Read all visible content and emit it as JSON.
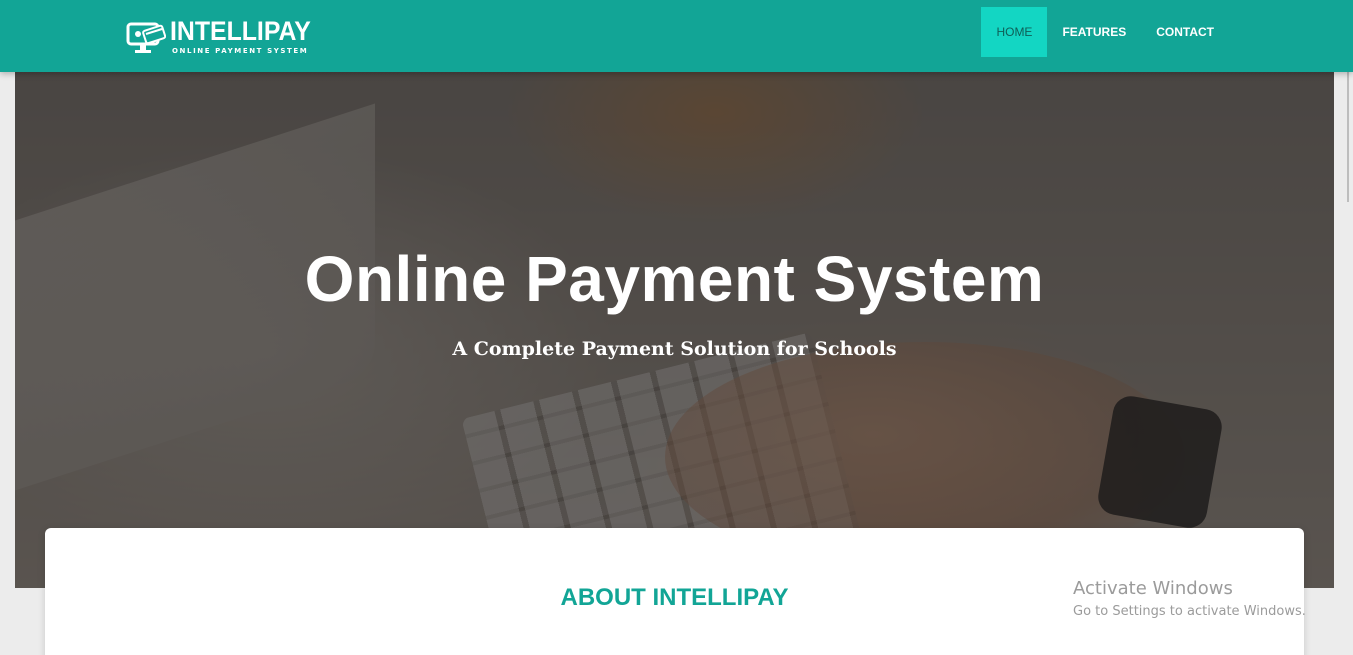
{
  "brand": {
    "name": "INTELLIPAY",
    "tagline": "ONLINE PAYMENT SYSTEM",
    "color": "#12a596"
  },
  "nav": {
    "items": [
      {
        "label": "HOME",
        "active": true
      },
      {
        "label": "FEATURES",
        "active": false
      },
      {
        "label": "CONTACT",
        "active": false
      }
    ],
    "active_color": "#13d6c3"
  },
  "hero": {
    "title": "Online Payment System",
    "subtitle": "A Complete Payment Solution for Schools"
  },
  "about": {
    "title": "ABOUT INTELLIPAY"
  },
  "watermark": {
    "title": "Activate Windows",
    "subtitle": "Go to Settings to activate Windows."
  }
}
